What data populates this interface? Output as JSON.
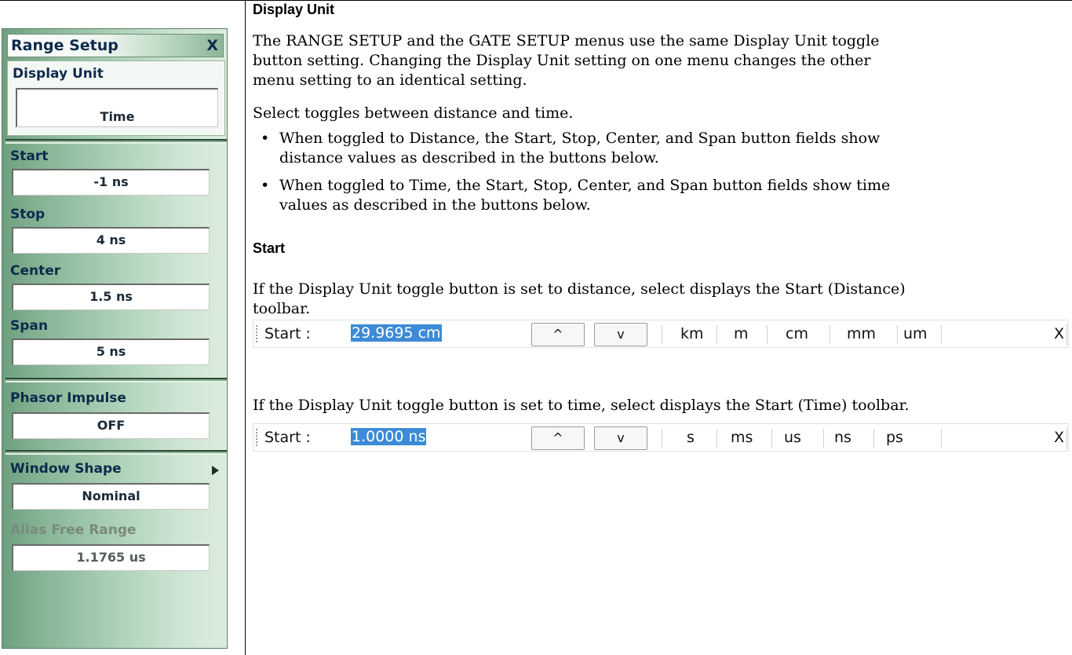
{
  "menu": {
    "title": "Range Setup",
    "close": "X",
    "display_unit": {
      "label": "Display Unit",
      "value": "Time"
    },
    "start": {
      "label": "Start",
      "value": "-1 ns"
    },
    "stop": {
      "label": "Stop",
      "value": "4 ns"
    },
    "center": {
      "label": "Center",
      "value": "1.5 ns"
    },
    "span": {
      "label": "Span",
      "value": "5 ns"
    },
    "phasor_impulse": {
      "label": "Phasor Impulse",
      "value": "OFF"
    },
    "window_shape": {
      "label": "Window Shape",
      "value": "Nominal"
    },
    "alias_free_range": {
      "label": "Alias Free Range",
      "value": "1.1765 us"
    }
  },
  "doc": {
    "h_display_unit": "Display Unit",
    "p1_line1": "The RANGE SETUP and the GATE SETUP menus use the same Display Unit toggle",
    "p1_line2": "button setting. Changing the Display Unit setting on one menu changes the other",
    "p1_line3": "menu setting to an identical setting.",
    "p2": "Select toggles between distance and time.",
    "b1_line1": "When toggled to Distance, the Start, Stop, Center, and Span button fields show",
    "b1_line2": "distance values as described in the buttons below.",
    "b2_line1": "When toggled to Time, the Start, Stop, Center, and Span button fields show time",
    "b2_line2": "values as described in the buttons below.",
    "bullet_symbol": "•",
    "h_start": "Start",
    "p3_line1": "If the Display Unit toggle button is set to distance, select displays the Start (Distance)",
    "p3_line2": "toolbar.",
    "p4": "If the Display Unit toggle button is set to time, select displays the Start (Time) toolbar."
  },
  "toolbar_distance": {
    "label": "Start  :",
    "value": "29.9695 cm",
    "up": "^",
    "down": "v",
    "units": [
      "km",
      "m",
      "cm",
      "mm",
      "um"
    ],
    "close": "X"
  },
  "toolbar_time": {
    "label": "Start  :",
    "value": "1.0000 ns",
    "up": "^",
    "down": "v",
    "units": [
      "s",
      "ms",
      "us",
      "ns",
      "ps"
    ],
    "close": "X"
  }
}
